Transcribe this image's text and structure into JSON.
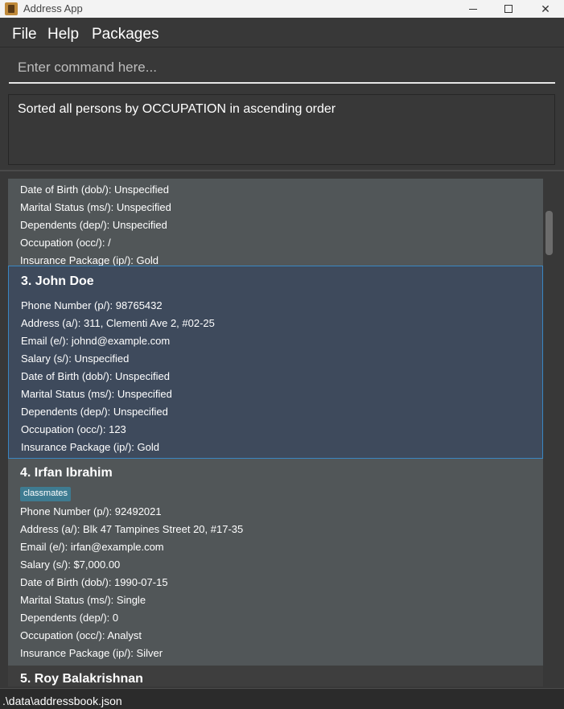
{
  "window": {
    "title": "Address App",
    "close_glyph": "✕"
  },
  "menu": [
    "File",
    "Help",
    "Packages"
  ],
  "command": {
    "placeholder": "Enter command here...",
    "value": ""
  },
  "result": "Sorted all persons by OCCUPATION in ascending order",
  "persons": [
    {
      "fields": [
        "Date of Birth (dob/): Unspecified",
        "Marital Status (ms/): Unspecified",
        "Dependents (dep/): Unspecified",
        "Occupation (occ/): /",
        "Insurance Package (ip/): Gold"
      ]
    },
    {
      "name": "3. John Doe",
      "fields": [
        "Phone Number (p/): 98765432",
        "Address (a/): 311, Clementi Ave 2, #02-25",
        "Email (e/): johnd@example.com",
        "Salary (s/): Unspecified",
        "Date of Birth (dob/): Unspecified",
        "Marital Status (ms/): Unspecified",
        "Dependents (dep/): Unspecified",
        "Occupation (occ/): 123",
        "Insurance Package (ip/): Gold"
      ]
    },
    {
      "name": "4. Irfan Ibrahim",
      "tag": "classmates",
      "fields": [
        "Phone Number (p/): 92492021",
        "Address (a/): Blk 47 Tampines Street 20, #17-35",
        "Email (e/): irfan@example.com",
        "Salary (s/): $7,000.00",
        "Date of Birth (dob/): 1990-07-15",
        "Marital Status (ms/): Single",
        "Dependents (dep/): 0",
        "Occupation (occ/): Analyst",
        "Insurance Package (ip/): Silver"
      ]
    },
    {
      "name": "5. Roy Balakrishnan"
    }
  ],
  "status": ".\\data\\addressbook.json"
}
